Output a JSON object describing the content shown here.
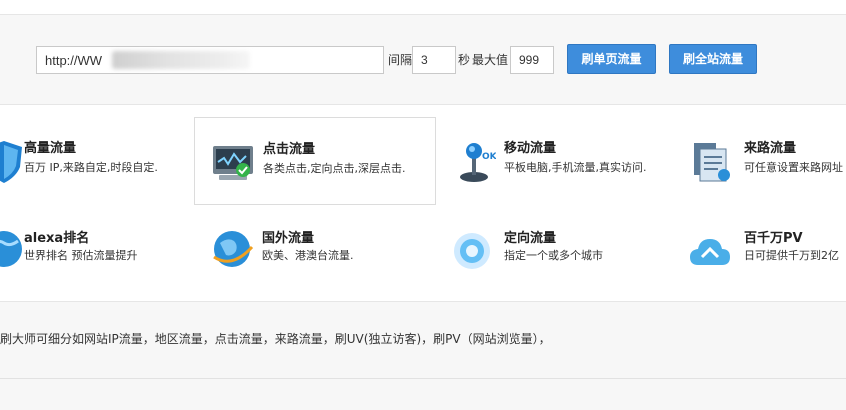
{
  "toolbar": {
    "url_value": "http://WW",
    "interval_label": "间隔",
    "interval_value": "3",
    "seconds_label": "秒",
    "max_label": "最大值",
    "max_value": "999",
    "btn_single": "刷单页流量",
    "btn_site": "刷全站流量"
  },
  "features": [
    {
      "title": "高量流量",
      "desc": "百万 IP,来路自定,时段自定.",
      "icon": "shield-icon"
    },
    {
      "title": "点击流量",
      "desc": "各类点击,定向点击,深层点击.",
      "icon": "monitor-check-icon"
    },
    {
      "title": "移动流量",
      "desc": "平板电脑,手机流量,真实访问.",
      "icon": "joystick-icon"
    },
    {
      "title": "来路流量",
      "desc": "可任意设置来路网址",
      "icon": "documents-icon"
    },
    {
      "title": "alexa排名",
      "desc": "世界排名 预估流量提升",
      "icon": "globe-icon"
    },
    {
      "title": "国外流量",
      "desc": "欧美、港澳台流量.",
      "icon": "globe-icon"
    },
    {
      "title": "定向流量",
      "desc": "指定一个或多个城市",
      "icon": "target-icon"
    },
    {
      "title": "百千万PV",
      "desc": "日可提供千万到2亿",
      "icon": "cloud-icon"
    }
  ],
  "bottom": {
    "text": "刷大师可细分如网站IP流量，地区流量，点击流量，来路流量，刷UV(独立访客)，刷PV（网站浏览量），"
  },
  "colors": {
    "button": "#3e8ddc",
    "accent_blue": "#2a8fd8"
  }
}
